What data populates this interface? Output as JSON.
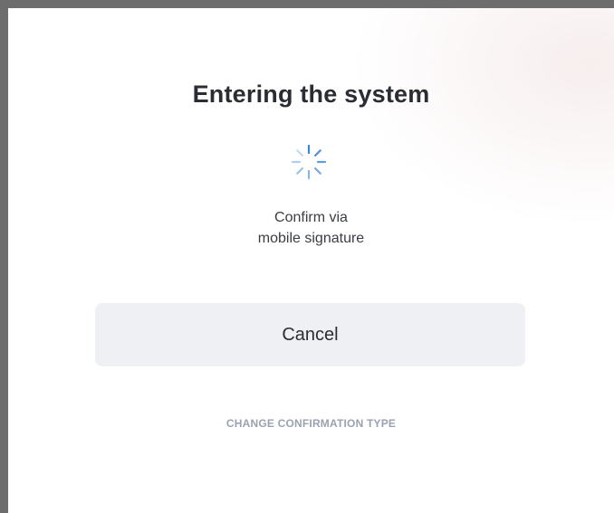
{
  "dialog": {
    "title": "Entering the system",
    "message_line1": "Confirm via",
    "message_line2": "mobile signature",
    "cancel_label": "Cancel",
    "change_type_label": "CHANGE CONFIRMATION TYPE"
  },
  "colors": {
    "spinner": "#3a86d8",
    "button_bg": "#eef0f4",
    "link": "#9aa2b1"
  },
  "icons": {
    "spinner": "loading-spinner-icon"
  }
}
